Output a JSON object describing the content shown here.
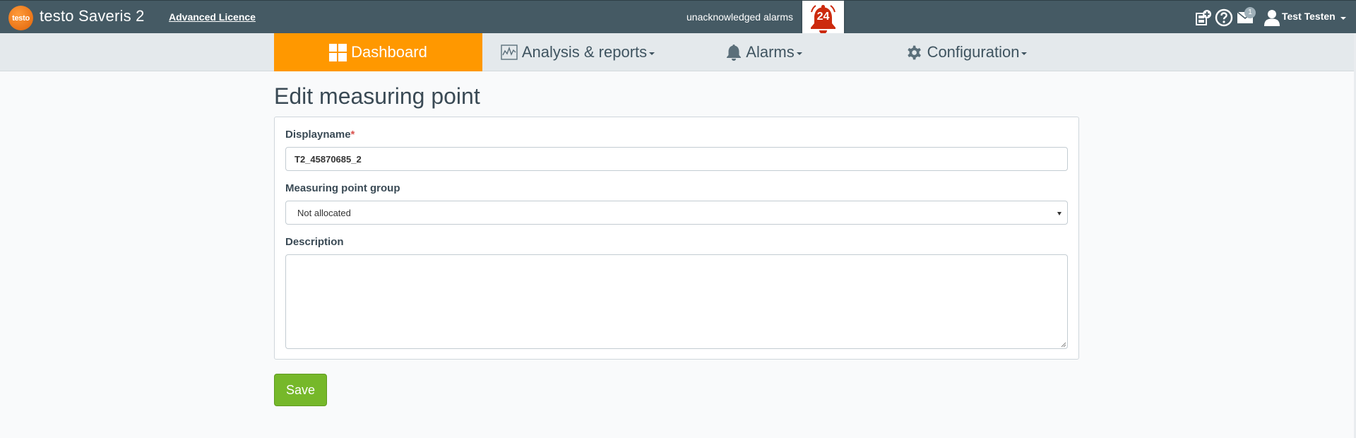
{
  "header": {
    "logo_text": "testo",
    "app_title": "testo Saveris 2",
    "licence_link": "Advanced Licence",
    "unacknowledged_label": "unacknowledged alarms",
    "alarm_count": "24",
    "mail_badge": "1",
    "user_name": "Test Testen",
    "icons": [
      "add-widget-icon",
      "help-icon",
      "mail-icon",
      "user-icon",
      "bell-icon"
    ]
  },
  "nav": {
    "items": [
      {
        "label": "Dashboard",
        "icon": "dashboard-grid-icon",
        "active": true,
        "dropdown": false
      },
      {
        "label": "Analysis & reports",
        "icon": "chart-icon",
        "active": false,
        "dropdown": true
      },
      {
        "label": "Alarms",
        "icon": "bell-icon",
        "active": false,
        "dropdown": true
      },
      {
        "label": "Configuration",
        "icon": "gear-icon",
        "active": false,
        "dropdown": true
      }
    ]
  },
  "form": {
    "title": "Edit measuring point",
    "displayname_label": "Displayname",
    "required_marker": "*",
    "displayname_value": "T2_45870685_2",
    "group_label": "Measuring point group",
    "group_value": "Not allocated",
    "description_label": "Description",
    "description_value": "",
    "save_label": "Save"
  },
  "colors": {
    "topbar": "#455a64",
    "navbar": "#e4e9ec",
    "active_tab": "#ff9800",
    "save_button": "#76b82a",
    "alarm_bell": "#cc2a0e",
    "logo": "#f07a1a"
  }
}
